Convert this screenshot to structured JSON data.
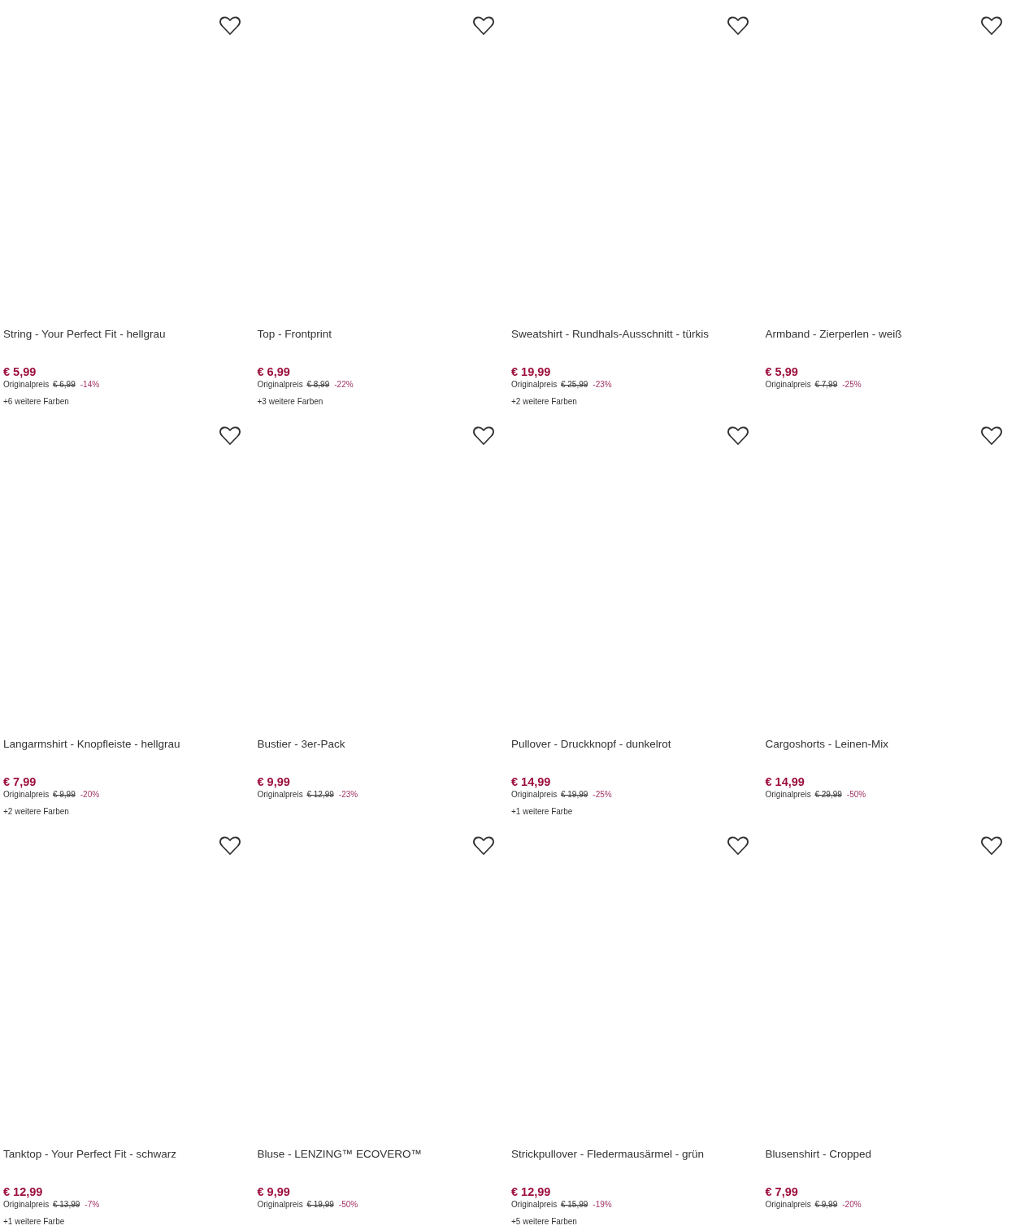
{
  "products": [
    {
      "title": "String - Your Perfect Fit - hellgrau",
      "price": "€ 5,99",
      "original_label": "Originalpreis",
      "original_price": "€ 6,99",
      "discount": "-14%",
      "colors": "+6 weitere Farben"
    },
    {
      "title": "Top - Frontprint",
      "price": "€ 6,99",
      "original_label": "Originalpreis",
      "original_price": "€ 8,99",
      "discount": "-22%",
      "colors": "+3 weitere Farben"
    },
    {
      "title": "Sweatshirt - Rundhals-Ausschnitt - türkis",
      "price": "€ 19,99",
      "original_label": "Originalpreis",
      "original_price": "€ 25,99",
      "discount": "-23%",
      "colors": "+2 weitere Farben"
    },
    {
      "title": "Armband - Zierperlen - weiß",
      "price": "€ 5,99",
      "original_label": "Originalpreis",
      "original_price": "€ 7,99",
      "discount": "-25%"
    },
    {
      "title": "Langarmshirt - Knopfleiste - hellgrau",
      "price": "€ 7,99",
      "original_label": "Originalpreis",
      "original_price": "€ 9,99",
      "discount": "-20%",
      "colors": "+2 weitere Farben"
    },
    {
      "title": "Bustier - 3er-Pack",
      "price": "€ 9,99",
      "original_label": "Originalpreis",
      "original_price": "€ 12,99",
      "discount": "-23%"
    },
    {
      "title": "Pullover - Druckknopf - dunkelrot",
      "price": "€ 14,99",
      "original_label": "Originalpreis",
      "original_price": "€ 19,99",
      "discount": "-25%",
      "colors": "+1 weitere Farbe"
    },
    {
      "title": "Cargoshorts - Leinen-Mix",
      "price": "€ 14,99",
      "original_label": "Originalpreis",
      "original_price": "€ 29,99",
      "discount": "-50%"
    },
    {
      "title": "Tanktop - Your Perfect Fit - schwarz",
      "price": "€ 12,99",
      "original_label": "Originalpreis",
      "original_price": "€ 13,99",
      "discount": "-7%",
      "colors": "+1 weitere Farbe"
    },
    {
      "title": "Bluse - LENZING™ ECOVERO™",
      "price": "€ 9,99",
      "original_label": "Originalpreis",
      "original_price": "€ 19,99",
      "discount": "-50%"
    },
    {
      "title": "Strickpullover - Fledermausärmel - grün",
      "price": "€ 12,99",
      "original_label": "Originalpreis",
      "original_price": "€ 15,99",
      "discount": "-19%",
      "colors": "+5 weitere Farben"
    },
    {
      "title": "Blusenshirt - Cropped",
      "price": "€ 7,99",
      "original_label": "Originalpreis",
      "original_price": "€ 9,99",
      "discount": "-20%"
    }
  ]
}
